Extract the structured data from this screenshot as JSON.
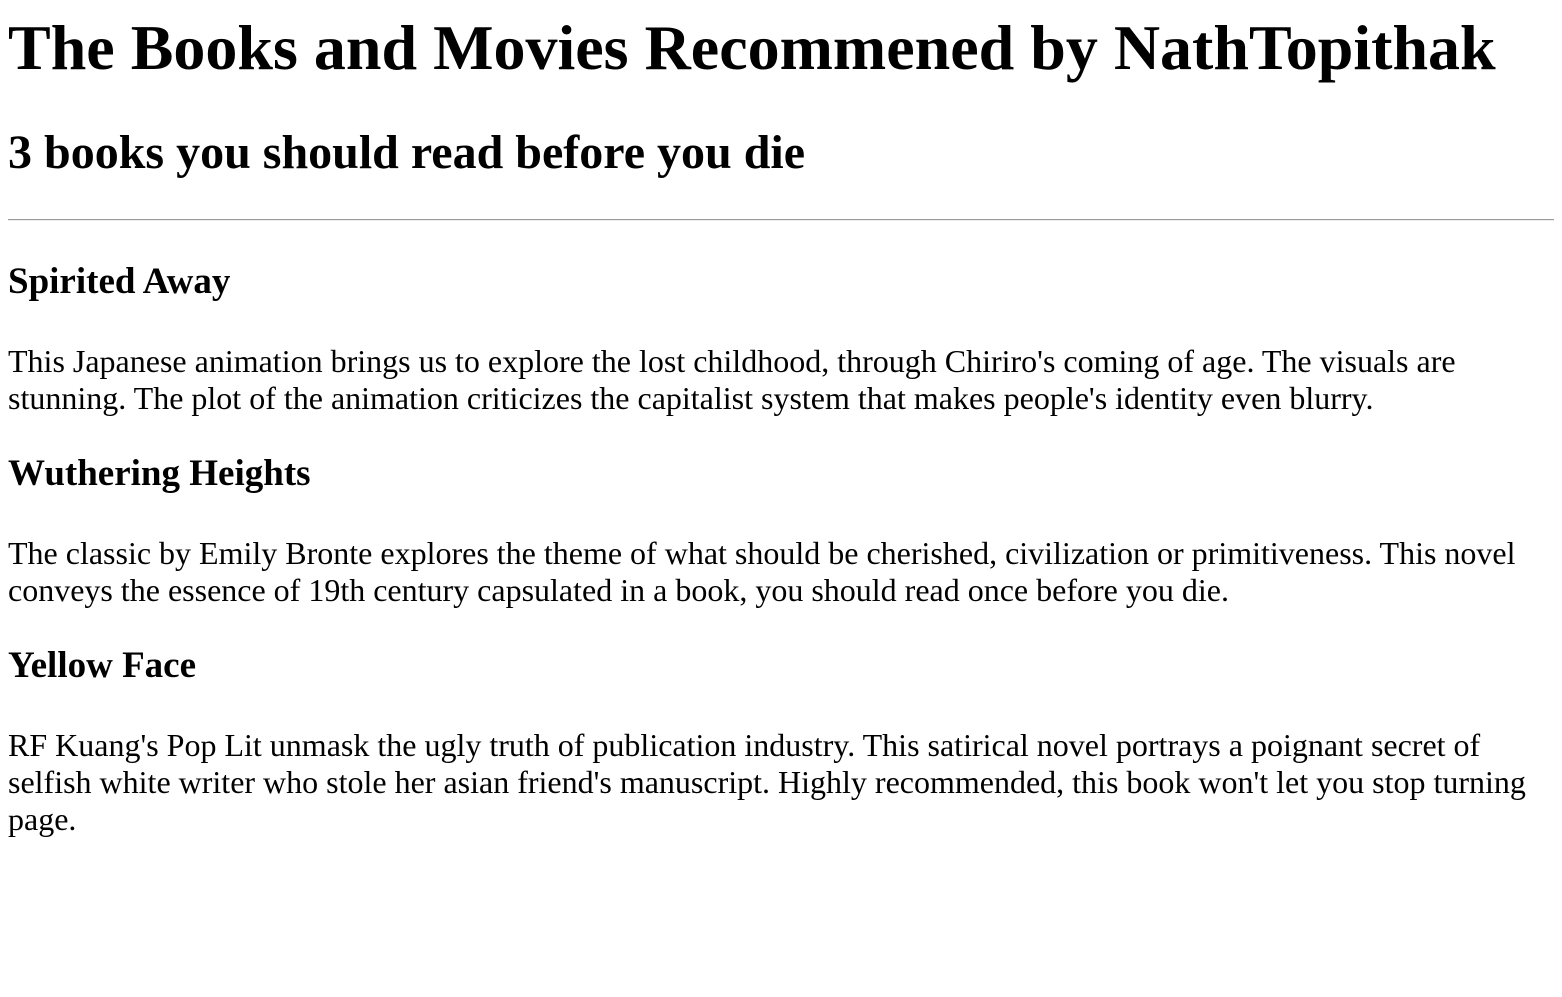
{
  "page": {
    "title": "The Books and Movies Recommened by NathTopithak",
    "subtitle": "3 books you should read before you die"
  },
  "entries": [
    {
      "title": "Spirited Away",
      "description": "This Japanese animation brings us to explore the lost childhood, through Chiriro's coming of age. The visuals are stunning. The plot of the animation criticizes the capitalist system that makes people's identity even blurry."
    },
    {
      "title": "Wuthering Heights",
      "description": "The classic by Emily Bronte explores the theme of what should be cherished, civilization or primitiveness. This novel conveys the essence of 19th century capsulated in a book, you should read once before you die."
    },
    {
      "title": "Yellow Face",
      "description": "RF Kuang's Pop Lit unmask the ugly truth of publication industry. This satirical novel portrays a poignant secret of selfish white writer who stole her asian friend's manuscript. Highly recommended, this book won't let you stop turning page."
    }
  ]
}
